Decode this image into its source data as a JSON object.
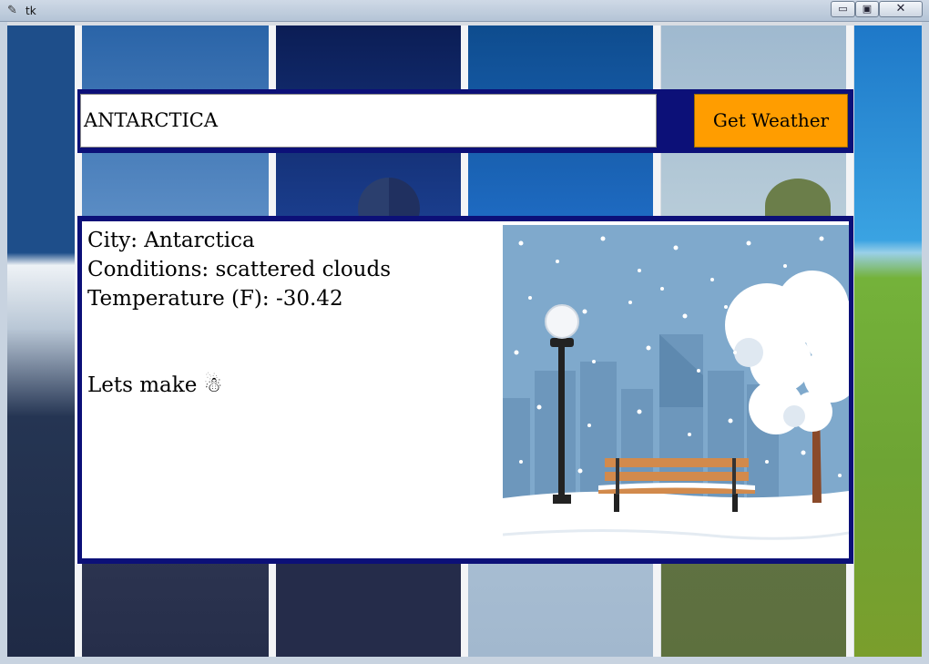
{
  "window": {
    "title": "tk",
    "controls": {
      "minimize": "▭",
      "maximize": "▣",
      "close": "✕"
    }
  },
  "search": {
    "city_value": "ANTARCTICA",
    "button_label": "Get Weather"
  },
  "result": {
    "city_line": "City: Antarctica",
    "conditions_line": "Conditions: scattered clouds",
    "temperature_line": "Temperature (F): -30.42",
    "message_line": "Lets make ☃"
  },
  "colors": {
    "frame_navy": "#0c1078",
    "button_orange": "#ff9d00",
    "sky_blue": "#7fa9cc"
  },
  "icons": {
    "window_icon": "feather-icon",
    "message_icon": "snowman-icon"
  }
}
